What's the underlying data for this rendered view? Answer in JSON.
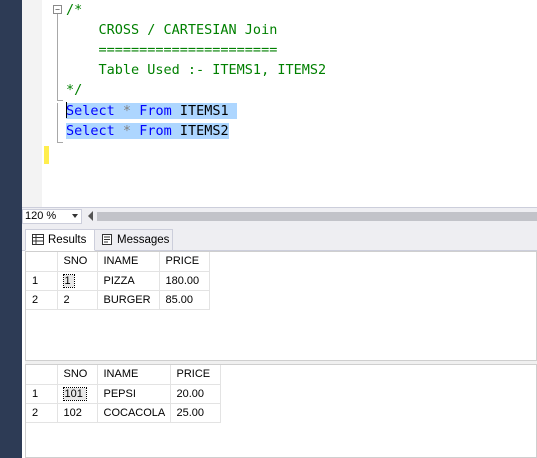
{
  "editor": {
    "lines": [
      {
        "text": "/*",
        "type": "comment"
      },
      {
        "text": "    CROSS / CARTESIAN Join",
        "type": "comment"
      },
      {
        "text": "    ======================",
        "type": "comment"
      },
      {
        "text": "    Table Used :- ITEMS1, ITEMS2",
        "type": "comment"
      },
      {
        "text": "*/",
        "type": "comment"
      }
    ],
    "query1": {
      "kw1": "Select",
      "op": "*",
      "kw2": "From",
      "table": "ITEMS1"
    },
    "query2": {
      "kw1": "Select",
      "op": "*",
      "kw2": "From",
      "table": "ITEMS2"
    },
    "collapse_glyph": "−"
  },
  "zoom": {
    "value": "120 %"
  },
  "tabs": {
    "results": "Results",
    "messages": "Messages"
  },
  "grid1": {
    "columns": [
      "SNO",
      "INAME",
      "PRICE"
    ],
    "rows": [
      {
        "num": "1",
        "sno": "1",
        "iname": "PIZZA",
        "price": "180.00"
      },
      {
        "num": "2",
        "sno": "2",
        "iname": "BURGER",
        "price": "85.00"
      }
    ]
  },
  "grid2": {
    "columns": [
      "SNO",
      "INAME",
      "PRICE"
    ],
    "rows": [
      {
        "num": "1",
        "sno": "101",
        "iname": "PEPSI",
        "price": "20.00"
      },
      {
        "num": "2",
        "sno": "102",
        "iname": "COCACOLA",
        "price": "25.00"
      }
    ]
  },
  "colors": {
    "comment": "#008000",
    "keyword": "#0000ff",
    "selection": "#add6ff",
    "sidebar": "#2d3b55"
  }
}
